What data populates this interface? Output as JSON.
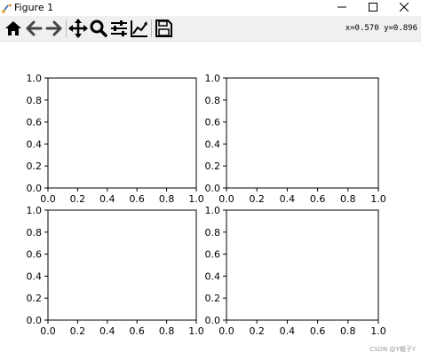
{
  "window": {
    "title": "Figure 1",
    "controls": {
      "minimize_icon": "minimize-icon",
      "maximize_icon": "maximize-icon",
      "close_icon": "close-icon"
    }
  },
  "toolbar": {
    "buttons": [
      {
        "name": "home",
        "icon": "home-icon"
      },
      {
        "name": "back",
        "icon": "arrow-left-icon"
      },
      {
        "name": "forward",
        "icon": "arrow-right-icon"
      },
      {
        "name": "pan",
        "icon": "move-icon"
      },
      {
        "name": "zoom",
        "icon": "magnifier-icon"
      },
      {
        "name": "configure-subplots",
        "icon": "sliders-icon"
      },
      {
        "name": "edit-axes",
        "icon": "line-chart-icon"
      },
      {
        "name": "save",
        "icon": "floppy-disk-icon"
      }
    ],
    "coordinates": "x=0.570  y=0.896"
  },
  "watermark": "CSDN @Y橘子Y",
  "chart_data": [
    {
      "type": "line",
      "series": [],
      "xlim": [
        0.0,
        1.0
      ],
      "ylim": [
        0.0,
        1.0
      ],
      "xticks": [
        "0.0",
        "0.2",
        "0.4",
        "0.6",
        "0.8",
        "1.0"
      ],
      "yticks": [
        "0.0",
        "0.2",
        "0.4",
        "0.6",
        "0.8",
        "1.0"
      ],
      "grid": false
    },
    {
      "type": "line",
      "series": [],
      "xlim": [
        0.0,
        1.0
      ],
      "ylim": [
        0.0,
        1.0
      ],
      "xticks": [
        "0.0",
        "0.2",
        "0.4",
        "0.6",
        "0.8",
        "1.0"
      ],
      "yticks": [
        "0.0",
        "0.2",
        "0.4",
        "0.6",
        "0.8",
        "1.0"
      ],
      "grid": false
    },
    {
      "type": "line",
      "series": [],
      "xlim": [
        0.0,
        1.0
      ],
      "ylim": [
        0.0,
        1.0
      ],
      "xticks": [
        "0.0",
        "0.2",
        "0.4",
        "0.6",
        "0.8",
        "1.0"
      ],
      "yticks": [
        "0.0",
        "0.2",
        "0.4",
        "0.6",
        "0.8",
        "1.0"
      ],
      "grid": false
    },
    {
      "type": "line",
      "series": [],
      "xlim": [
        0.0,
        1.0
      ],
      "ylim": [
        0.0,
        1.0
      ],
      "xticks": [
        "0.0",
        "0.2",
        "0.4",
        "0.6",
        "0.8",
        "1.0"
      ],
      "yticks": [
        "0.0",
        "0.2",
        "0.4",
        "0.6",
        "0.8",
        "1.0"
      ],
      "grid": false
    }
  ]
}
